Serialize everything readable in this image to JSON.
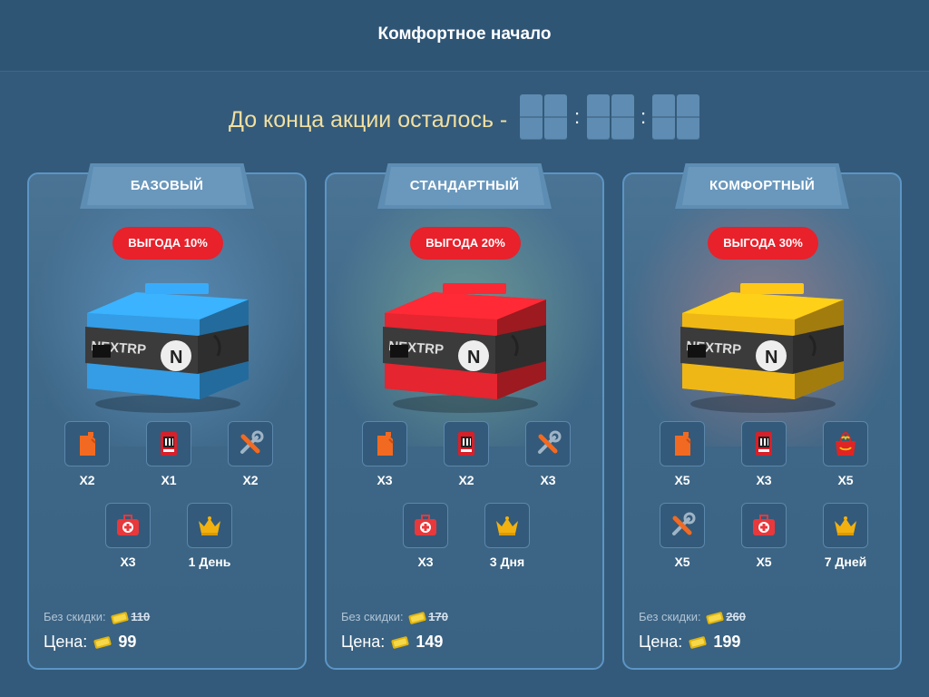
{
  "page": {
    "title": "Комфортное начало"
  },
  "timer": {
    "label": "До конца акции осталось -",
    "separator": ":"
  },
  "cards": [
    {
      "name": "БАЗОВЫЙ",
      "badge": "ВЫГОДА 10%",
      "box_color": "#2f8fd0",
      "items": [
        {
          "icon": "fuel-can-icon",
          "qty": "X2"
        },
        {
          "icon": "lottery-ticket-icon",
          "qty": "X1"
        },
        {
          "icon": "repair-kit-icon",
          "qty": "X2"
        },
        {
          "icon": "first-aid-kit-icon",
          "qty": "X3"
        },
        {
          "icon": "vip-crown-icon",
          "qty": "1 День"
        }
      ],
      "old_label": "Без скидки:",
      "old_price": "110",
      "price_label": "Цена:",
      "price": "99"
    },
    {
      "name": "СТАНДАРТНЫЙ",
      "badge": "ВЫГОДА 20%",
      "box_color": "#d0222b",
      "items": [
        {
          "icon": "fuel-can-icon",
          "qty": "X3"
        },
        {
          "icon": "lottery-ticket-icon",
          "qty": "X2"
        },
        {
          "icon": "repair-kit-icon",
          "qty": "X3"
        },
        {
          "icon": "first-aid-kit-icon",
          "qty": "X3"
        },
        {
          "icon": "vip-crown-icon",
          "qty": "3 Дня"
        }
      ],
      "old_label": "Без скидки:",
      "old_price": "170",
      "price_label": "Цена:",
      "price": "149"
    },
    {
      "name": "КОМФОРТНЫЙ",
      "badge": "ВЫГОДА 30%",
      "box_color": "#d9a613",
      "items": [
        {
          "icon": "fuel-can-icon",
          "qty": "X5"
        },
        {
          "icon": "lottery-ticket-icon",
          "qty": "X3"
        },
        {
          "icon": "food-box-icon",
          "qty": "X5"
        },
        {
          "icon": "repair-kit-icon",
          "qty": "X5"
        },
        {
          "icon": "first-aid-kit-icon",
          "qty": "X5"
        },
        {
          "icon": "vip-crown-icon",
          "qty": "7 Дней"
        }
      ],
      "old_label": "Без скидки:",
      "old_price": "260",
      "price_label": "Цена:",
      "price": "199"
    }
  ],
  "box_brand": {
    "text": "NEXTRP",
    "logo_letter": "N"
  },
  "colors": {
    "background": "#335a7a",
    "card_border": "#5c95c5",
    "badge": "#e8212b",
    "timer_label": "#f2dfa0"
  }
}
